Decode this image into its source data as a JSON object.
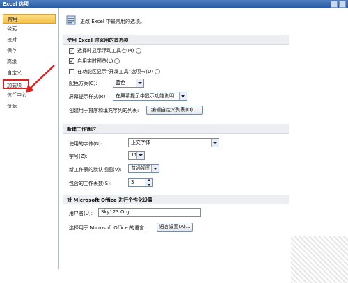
{
  "window": {
    "title": "Excel 选项"
  },
  "sidebar": {
    "items": [
      {
        "label": "常用"
      },
      {
        "label": "公式"
      },
      {
        "label": "校对"
      },
      {
        "label": "保存"
      },
      {
        "label": "高级"
      },
      {
        "label": "自定义"
      },
      {
        "label": "加载项"
      },
      {
        "label": "信任中心"
      },
      {
        "label": "资源"
      }
    ],
    "selected_index": 0,
    "highlight_index": 6,
    "highlight_color": "#e02020"
  },
  "main": {
    "intro": "更改 Excel 中最常用的选项。",
    "top_section": {
      "title": "使用 Excel 时采用的首选项",
      "show_mini_toolbar": {
        "label": "选择时显示浮动工具栏(M)",
        "checked": true
      },
      "live_preview": {
        "label": "启用实时预览(L)",
        "checked": true
      },
      "developer_tab": {
        "label": "在功能区显示“开发工具”选项卡(D)",
        "checked": false
      },
      "color_scheme": {
        "label": "配色方案(C):",
        "value": "蓝色"
      },
      "screentip_style": {
        "label": "屏幕提示样式(R):",
        "value": "在屏幕提示中显示功能说明"
      },
      "custom_lists": {
        "label": "创建用于排序和填充序列的列表:",
        "button": "编辑自定义列表(O)..."
      }
    },
    "new_workbook_section": {
      "title": "新建工作簿时",
      "font": {
        "label": "使用的字体(N):",
        "value": "正文字体"
      },
      "font_size": {
        "label": "字号(Z):",
        "value": "11"
      },
      "default_view": {
        "label": "新工作表的默认视图(V):",
        "value": "普通视图"
      },
      "sheet_count": {
        "label": "包含的工作表数(S):",
        "value": "3"
      }
    },
    "personalize_section": {
      "title": "对 Microsoft Office 进行个性化设置",
      "user_name": {
        "label": "用户名(U):",
        "value": "Sky123.Org"
      },
      "language": {
        "label": "选择用于 Microsoft Office 的语言:",
        "button": "语言设置(A)..."
      }
    }
  },
  "colors": {
    "title_bar": "#24589f",
    "selected_item": "#f7bf45",
    "section_header": "#eceef1"
  }
}
